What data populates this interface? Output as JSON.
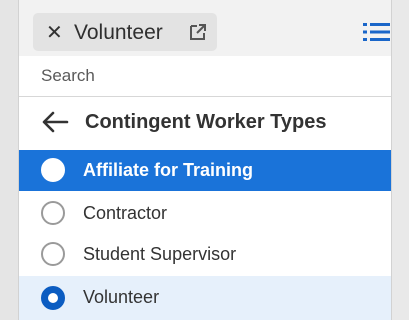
{
  "chip": {
    "label": "Volunteer",
    "remove_icon": "close-icon",
    "link_icon": "external-link-icon"
  },
  "header": {
    "list_icon": "list-icon"
  },
  "search": {
    "placeholder": "Search"
  },
  "back": {
    "icon": "back-arrow-icon",
    "title": "Contingent Worker Types"
  },
  "options": [
    {
      "label": "Affiliate for Training",
      "state": "highlighted"
    },
    {
      "label": "Contractor",
      "state": "unselected"
    },
    {
      "label": "Student Supervisor",
      "state": "unselected"
    },
    {
      "label": "Volunteer",
      "state": "selected"
    }
  ],
  "colors": {
    "highlight": "#1a73d9",
    "selected_row": "#e6f0fb",
    "radio_selected": "#0b5cc1",
    "accent_icon": "#1a66c9"
  }
}
